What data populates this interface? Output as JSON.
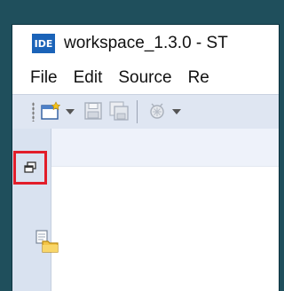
{
  "window": {
    "app_badge": "IDE",
    "title": "workspace_1.3.0 - ST"
  },
  "menu": [
    "File",
    "Edit",
    "Source",
    "Re"
  ],
  "toolbar": {
    "icons": [
      "new-wizard-icon",
      "dropdown-arrow-icon",
      "save-icon",
      "save-all-icon",
      "debug-icon",
      "dropdown-arrow-icon"
    ]
  },
  "sidebar": {
    "icons": [
      "restore-icon",
      "package-explorer-icon"
    ],
    "highlight_color": "#e21d2a"
  }
}
